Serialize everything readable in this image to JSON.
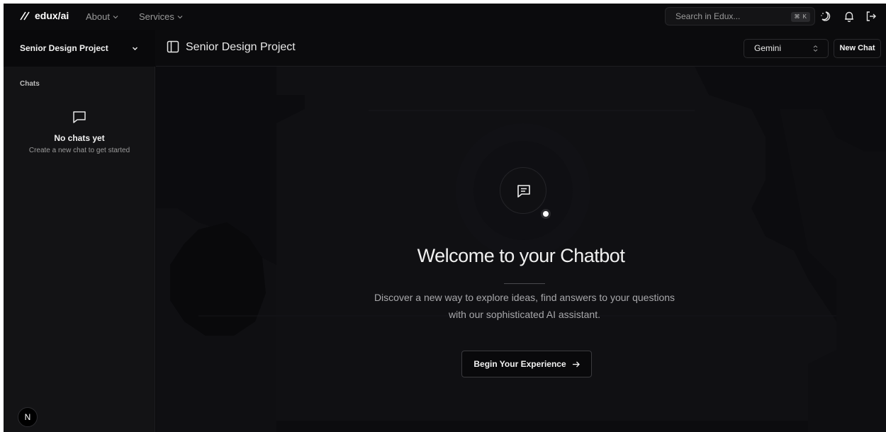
{
  "brand": {
    "name": "edux/ai"
  },
  "nav": {
    "items": [
      {
        "label": "About"
      },
      {
        "label": "Services"
      }
    ]
  },
  "search": {
    "placeholder": "Search in Edux...",
    "shortcut": "⌘ K"
  },
  "sidebar": {
    "project": "Senior Design Project",
    "section_label": "Chats",
    "empty_title": "No chats yet",
    "empty_subtitle": "Create a new chat to get started",
    "avatar_initial": "N"
  },
  "header": {
    "title": "Senior Design Project",
    "model": "Gemini",
    "new_chat_label": "New Chat"
  },
  "hero": {
    "title": "Welcome to your Chatbot",
    "description": "Discover a new way to explore ideas, find answers to your questions with our sophisticated AI assistant.",
    "cta_label": "Begin Your Experience"
  },
  "icons": {
    "brand": "slash-logo-icon",
    "theme": "moon-stars-icon",
    "notifications": "bell-icon",
    "logout": "logout-icon",
    "sidebar_toggle": "sidebar-panel-icon",
    "empty_state": "message-square-icon",
    "hero": "message-text-icon",
    "cta": "arrow-right-icon"
  },
  "colors": {
    "background": "#0b0b0d",
    "sidebar": "#131315",
    "text": "#e8e8e8",
    "muted": "#9a9a9a",
    "accent": "#ffffff"
  }
}
